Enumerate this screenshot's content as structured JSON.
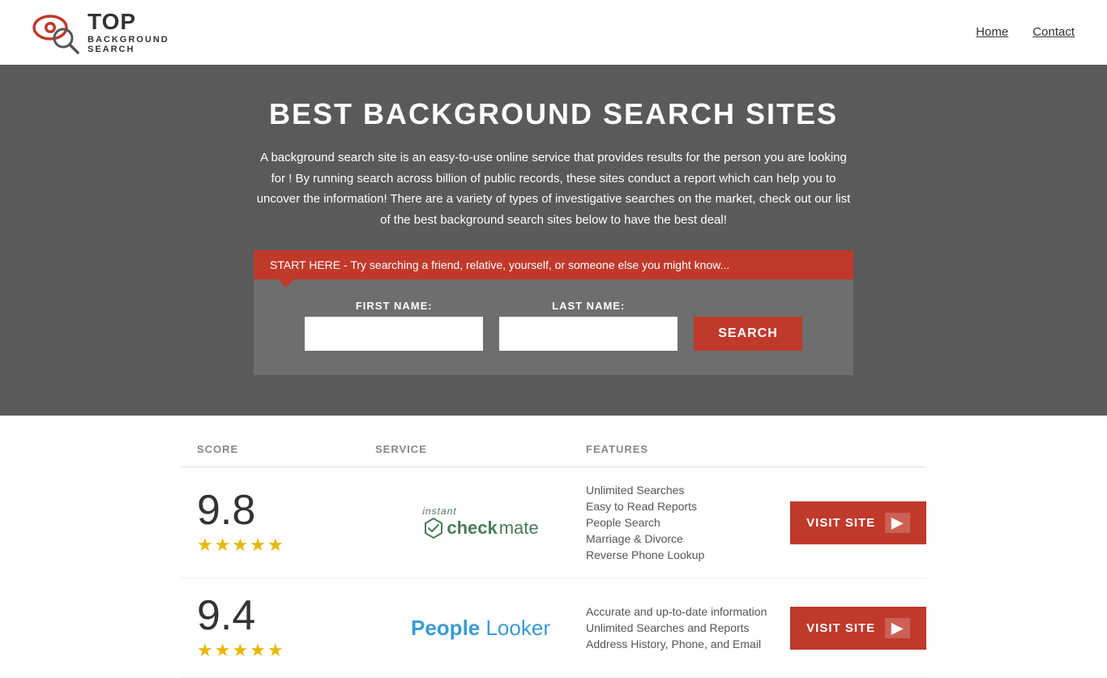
{
  "header": {
    "logo_top": "TOP",
    "logo_bottom": "BACKGROUND\nSEARCH",
    "nav": {
      "home_label": "Home",
      "contact_label": "Contact"
    }
  },
  "hero": {
    "title": "BEST BACKGROUND SEARCH SITES",
    "description": "A background search site is an easy-to-use online service that provides results  for the person you are looking for ! By  running  search across billion of public records, these sites conduct  a report which can help you to uncover the information! There are a variety of types of investigative searches on the market, check out our  list of the best background search sites below to have the best deal!",
    "callout": "START HERE - Try searching a friend, relative, yourself, or someone else you might know...",
    "form": {
      "first_name_label": "FIRST NAME:",
      "last_name_label": "LAST NAME:",
      "search_button": "SEARCH"
    }
  },
  "table": {
    "headers": {
      "score": "SCORE",
      "service": "SERVICE",
      "features": "FEATURES",
      "action": ""
    },
    "rows": [
      {
        "score": "9.8",
        "stars": 4.5,
        "service_name": "Instant Checkmate",
        "features": [
          "Unlimited Searches",
          "Easy to Read Reports",
          "People Search",
          "Marriage & Divorce",
          "Reverse Phone Lookup"
        ],
        "visit_label": "VISIT SITE"
      },
      {
        "score": "9.4",
        "stars": 4.5,
        "service_name": "PeopleLooker",
        "features": [
          "Accurate and up-to-date information",
          "Unlimited Searches and Reports",
          "Address History, Phone, and Email"
        ],
        "visit_label": "VISIT SITE"
      }
    ]
  }
}
